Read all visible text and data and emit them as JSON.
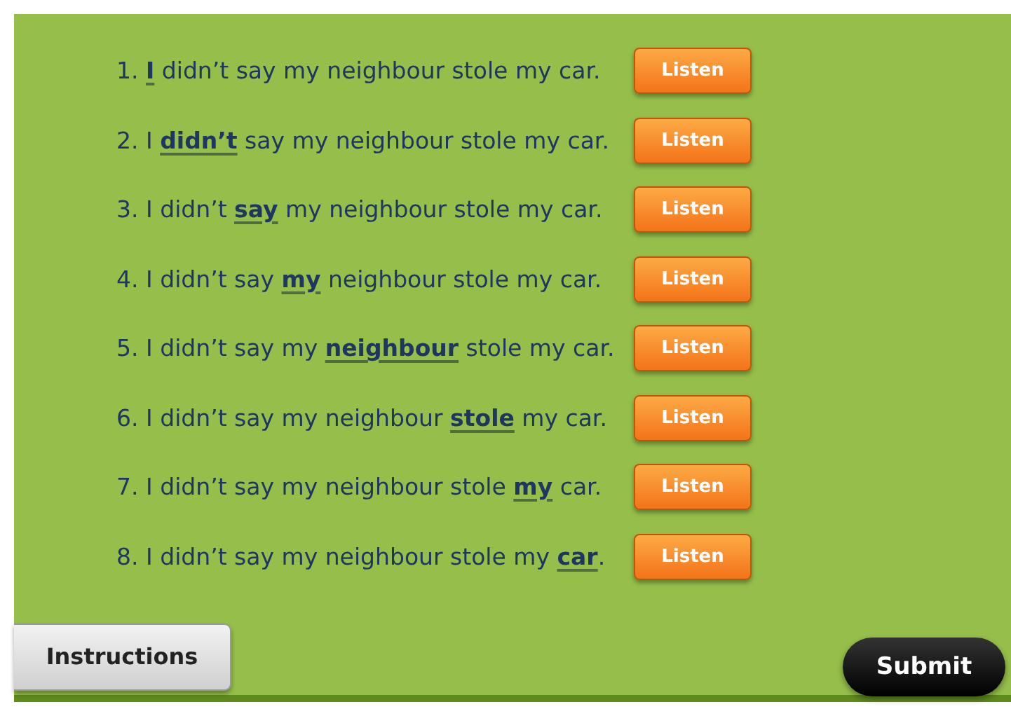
{
  "sentences": [
    {
      "text": "1. **I** didn’t say my neighbour stole my car.",
      "button": "Listen"
    },
    {
      "text": "2. I **didn’t** say my neighbour stole my car.",
      "button": "Listen"
    },
    {
      "text": "3. I didn’t **say** my neighbour stole my car.",
      "button": "Listen"
    },
    {
      "text": "4. I didn’t say **my** neighbour stole my car.",
      "button": "Listen"
    },
    {
      "text": "5. I didn’t say my **neighbour** stole my car.",
      "button": "Listen"
    },
    {
      "text": "6. I didn’t say my neighbour **stole** my car.",
      "button": "Listen"
    },
    {
      "text": "7. I didn’t say my neighbour stole **my** car.",
      "button": "Listen"
    },
    {
      "text": "8. I didn’t say my neighbour stole my **car**.",
      "button": "Listen"
    }
  ],
  "instructions_button": "Instructions",
  "submit_button": "Submit"
}
